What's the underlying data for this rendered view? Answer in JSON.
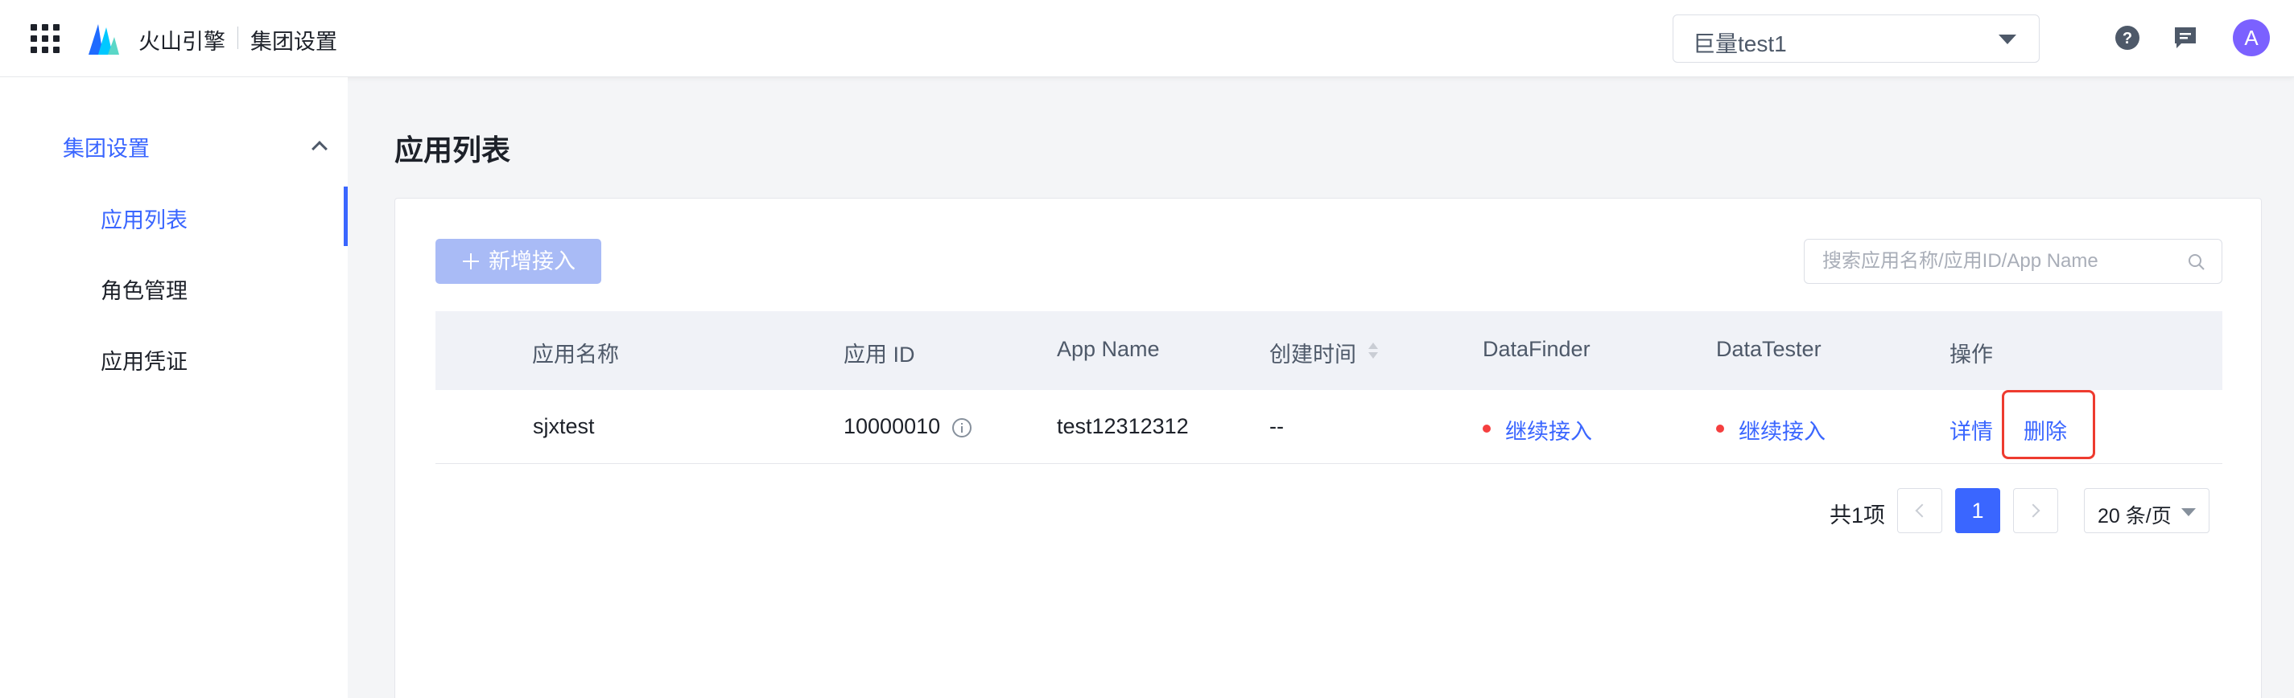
{
  "topbar": {
    "brand": "火山引擎",
    "section": "集团设置",
    "tenant_select_value": "巨量test1",
    "avatar_letter": "A",
    "icons": [
      "apps-grid-icon",
      "volcano-logo",
      "help-icon",
      "message-icon"
    ]
  },
  "sidebar": {
    "group_label": "集团设置",
    "items": [
      {
        "label": "应用列表",
        "active": true
      },
      {
        "label": "角色管理",
        "active": false
      },
      {
        "label": "应用凭证",
        "active": false
      }
    ]
  },
  "main": {
    "page_title": "应用列表",
    "add_button_label": "新增接入",
    "search_placeholder": "搜索应用名称/应用ID/App Name",
    "table": {
      "headers": [
        "应用名称",
        "应用 ID",
        "App Name",
        "创建时间",
        "DataFinder",
        "DataTester",
        "操作"
      ],
      "rows": [
        {
          "app_name": "sjxtest",
          "app_id": "10000010",
          "app_name_en": "test12312312",
          "created_at": "--",
          "datafinder": "继续接入",
          "datatester": "继续接入",
          "action_detail": "详情",
          "action_delete": "删除"
        }
      ]
    },
    "pagination": {
      "total_text": "共1项",
      "current_page": "1",
      "page_size": "20 条/页"
    }
  },
  "colors": {
    "accent": "#3a66ff",
    "add_button_disabled": "#a9bbf6",
    "status_dot": "#f53f3f",
    "highlight_box": "#ee3b2f",
    "avatar": "#7b61ff"
  }
}
